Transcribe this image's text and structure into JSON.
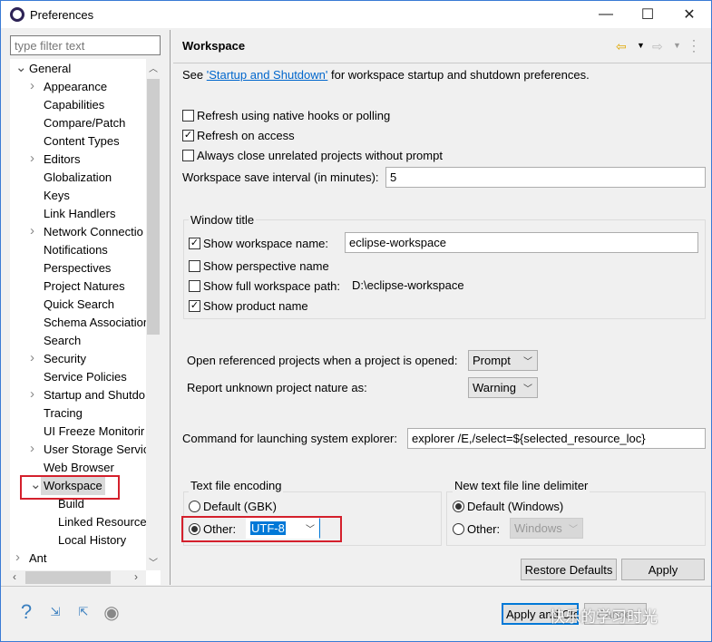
{
  "window": {
    "title": "Preferences",
    "icon": "eclipse-icon",
    "minimize": "—",
    "maximize": "☐",
    "close": "✕"
  },
  "filter": {
    "placeholder": "type filter text",
    "value": ""
  },
  "tree": {
    "items": [
      {
        "label": "General",
        "level": 0,
        "arrow": "expanded"
      },
      {
        "label": "Appearance",
        "level": 1,
        "arrow": "collapsed"
      },
      {
        "label": "Capabilities",
        "level": 1,
        "arrow": ""
      },
      {
        "label": "Compare/Patch",
        "level": 1,
        "arrow": ""
      },
      {
        "label": "Content Types",
        "level": 1,
        "arrow": ""
      },
      {
        "label": "Editors",
        "level": 1,
        "arrow": "collapsed"
      },
      {
        "label": "Globalization",
        "level": 1,
        "arrow": ""
      },
      {
        "label": "Keys",
        "level": 1,
        "arrow": ""
      },
      {
        "label": "Link Handlers",
        "level": 1,
        "arrow": ""
      },
      {
        "label": "Network Connectio",
        "level": 1,
        "arrow": "collapsed"
      },
      {
        "label": "Notifications",
        "level": 1,
        "arrow": ""
      },
      {
        "label": "Perspectives",
        "level": 1,
        "arrow": ""
      },
      {
        "label": "Project Natures",
        "level": 1,
        "arrow": ""
      },
      {
        "label": "Quick Search",
        "level": 1,
        "arrow": ""
      },
      {
        "label": "Schema Associatior",
        "level": 1,
        "arrow": ""
      },
      {
        "label": "Search",
        "level": 1,
        "arrow": ""
      },
      {
        "label": "Security",
        "level": 1,
        "arrow": "collapsed"
      },
      {
        "label": "Service Policies",
        "level": 1,
        "arrow": ""
      },
      {
        "label": "Startup and Shutdo",
        "level": 1,
        "arrow": "collapsed"
      },
      {
        "label": "Tracing",
        "level": 1,
        "arrow": ""
      },
      {
        "label": "UI Freeze Monitorir",
        "level": 1,
        "arrow": ""
      },
      {
        "label": "User Storage Servic",
        "level": 1,
        "arrow": "collapsed"
      },
      {
        "label": "Web Browser",
        "level": 1,
        "arrow": ""
      },
      {
        "label": "Workspace",
        "level": 1,
        "arrow": "expanded",
        "selected": true
      },
      {
        "label": "Build",
        "level": 2,
        "arrow": ""
      },
      {
        "label": "Linked Resource",
        "level": 2,
        "arrow": ""
      },
      {
        "label": "Local History",
        "level": 2,
        "arrow": ""
      },
      {
        "label": "Ant",
        "level": 0,
        "arrow": "collapsed"
      }
    ]
  },
  "page": {
    "title": "Workspace",
    "intro_prefix": "See ",
    "intro_link": "'Startup and Shutdown'",
    "intro_suffix": " for workspace startup and shutdown preferences.",
    "refresh_native": {
      "label": "Refresh using native hooks or polling",
      "checked": false
    },
    "refresh_access": {
      "label": "Refresh on access",
      "checked": true
    },
    "always_close": {
      "label": "Always close unrelated projects without prompt",
      "checked": false
    },
    "save_interval": {
      "label": "Workspace save interval (in minutes):",
      "value": "5"
    },
    "window_title": {
      "group_label": "Window title",
      "show_ws_name": {
        "label": "Show workspace name:",
        "checked": true,
        "value": "eclipse-workspace"
      },
      "show_perspective": {
        "label": "Show perspective name",
        "checked": false
      },
      "show_full_path": {
        "label": "Show full workspace path:",
        "checked": false,
        "value": "D:\\eclipse-workspace"
      },
      "show_product": {
        "label": "Show product name",
        "checked": true
      }
    },
    "open_ref": {
      "label": "Open referenced projects when a project is opened:",
      "value": "Prompt"
    },
    "report_unknown": {
      "label": "Report unknown project nature as:",
      "value": "Warning"
    },
    "explorer_cmd": {
      "label": "Command for launching system explorer:",
      "value": "explorer /E,/select=${selected_resource_loc}"
    },
    "encoding": {
      "group_label": "Text file encoding",
      "default_label": "Default (GBK)",
      "other_label": "Other:",
      "other_value": "UTF-8",
      "selected": "other"
    },
    "delimiter": {
      "group_label": "New text file line delimiter",
      "default_label": "Default (Windows)",
      "other_label": "Other:",
      "other_value": "Windows",
      "selected": "default"
    },
    "restore_defaults": "Restore Defaults",
    "apply": "Apply"
  },
  "footer": {
    "apply_close": "Apply and Close",
    "cancel": "Cancel",
    "watermark": "快乐的学习时光"
  },
  "colors": {
    "highlight": "#d4202c",
    "link": "#0066cc",
    "selection": "#0078d7"
  }
}
